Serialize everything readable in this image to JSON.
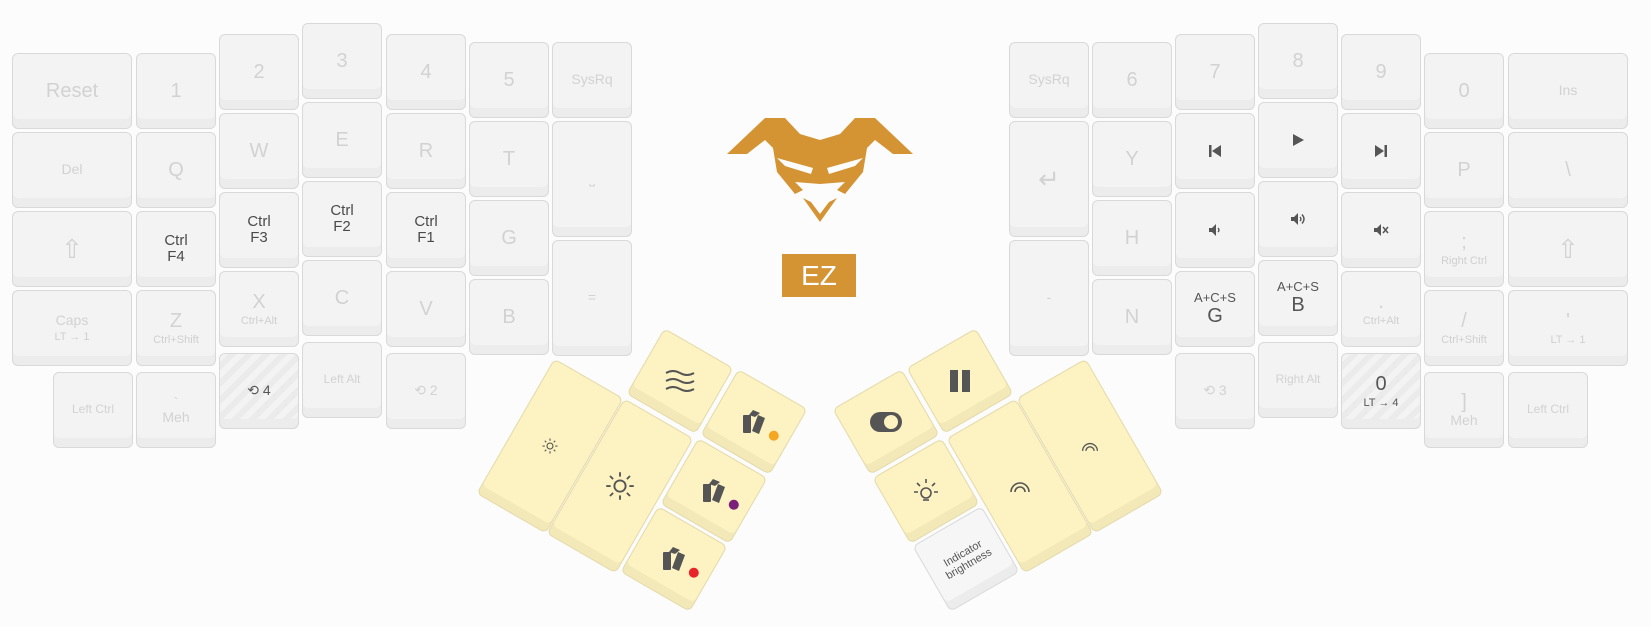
{
  "brand": {
    "accent": "#d49434",
    "badge": "EZ"
  },
  "left_keys": [
    {
      "label": "Reset",
      "style": "dark"
    },
    {
      "label": "1"
    },
    {
      "label": "2"
    },
    {
      "label": "3"
    },
    {
      "label": "4"
    },
    {
      "label": "5"
    },
    {
      "label": "SysRq",
      "style": "small"
    },
    {
      "label": "Del",
      "style": "small"
    },
    {
      "label": "Q"
    },
    {
      "label": "W"
    },
    {
      "label": "E"
    },
    {
      "label": "R"
    },
    {
      "label": "T"
    },
    {
      "label": "⎵",
      "style": "small"
    },
    {
      "label": "⇧"
    },
    {
      "label": "Ctrl",
      "sub": "F4",
      "style": "ctrl"
    },
    {
      "label": "Ctrl",
      "sub": "F3",
      "style": "ctrl"
    },
    {
      "label": "Ctrl",
      "sub": "F2",
      "style": "ctrl"
    },
    {
      "label": "Ctrl",
      "sub": "F1",
      "style": "ctrl"
    },
    {
      "label": "G"
    },
    {
      "label": "=",
      "style": "small"
    },
    {
      "label": "Caps",
      "sub": "LT → 1",
      "style": "small"
    },
    {
      "label": "Z",
      "sub": "Ctrl+Shift"
    },
    {
      "label": "X",
      "sub": "Ctrl+Alt"
    },
    {
      "label": "C"
    },
    {
      "label": "V"
    },
    {
      "label": "B"
    },
    {
      "label": "Left Ctrl",
      "style": "tiny"
    },
    {
      "label": "`",
      "sub": "Meh"
    },
    {
      "label": "⟲ 4",
      "style": "striped"
    },
    {
      "label": "Left Alt",
      "style": "tiny"
    },
    {
      "label": "⟲ 2",
      "style": "small"
    }
  ],
  "right_keys": [
    {
      "label": "SysRq",
      "style": "small"
    },
    {
      "label": "6"
    },
    {
      "label": "7"
    },
    {
      "label": "8"
    },
    {
      "label": "9"
    },
    {
      "label": "0"
    },
    {
      "label": "Ins",
      "style": "small"
    },
    {
      "label": "↵"
    },
    {
      "label": "Y"
    },
    {
      "icon": "previous-track-icon",
      "glyph": "⏮",
      "style": "iconkey"
    },
    {
      "icon": "play-icon",
      "glyph": "▶",
      "style": "iconkey"
    },
    {
      "icon": "next-track-icon",
      "glyph": "⏭",
      "style": "iconkey"
    },
    {
      "label": "P"
    },
    {
      "label": "\\"
    },
    {
      "label": "-",
      "style": "small"
    },
    {
      "label": "H"
    },
    {
      "icon": "volume-down-icon",
      "glyph": "🔈",
      "style": "iconkey"
    },
    {
      "icon": "volume-up-icon",
      "glyph": "🔊",
      "style": "iconkey"
    },
    {
      "icon": "mute-icon",
      "glyph": "🔇",
      "style": "iconkey"
    },
    {
      "label": ";",
      "sub": "Right Ctrl"
    },
    {
      "label": "⇧"
    },
    {
      "label": "N"
    },
    {
      "top": "A+C+S",
      "label": "G",
      "style": "acs"
    },
    {
      "top": "A+C+S",
      "label": "B",
      "style": "acs"
    },
    {
      "label": ".",
      "sub": "Ctrl+Alt"
    },
    {
      "label": "/",
      "sub": "Ctrl+Shift"
    },
    {
      "label": "'",
      "sub": "LT → 1"
    },
    {
      "label": "⟲ 3",
      "style": "small"
    },
    {
      "label": "Right Alt",
      "style": "tiny"
    },
    {
      "label": "0",
      "sub": "LT → 4",
      "style": "striped"
    },
    {
      "label": "]",
      "sub": "Meh"
    },
    {
      "label": "Left Ctrl",
      "style": "tiny"
    }
  ],
  "thumb_left": [
    {
      "icon": "brightness-down-icon"
    },
    {
      "icon": "brightness-up-icon"
    },
    {
      "icon": "wave-icon"
    },
    {
      "icon": "color-swatch-icon",
      "dot": "#f5a623"
    },
    {
      "icon": "color-swatch-icon",
      "dot": "#7b1f7b"
    },
    {
      "icon": "color-swatch-icon",
      "dot": "#e8262a"
    }
  ],
  "thumb_right": [
    {
      "icon": "toggle-icon"
    },
    {
      "icon": "pause-icon"
    },
    {
      "icon": "led-icon"
    },
    {
      "label": "Indicator brightness"
    },
    {
      "icon": "rainbow-icon"
    },
    {
      "icon": "rainbow-icon"
    }
  ]
}
